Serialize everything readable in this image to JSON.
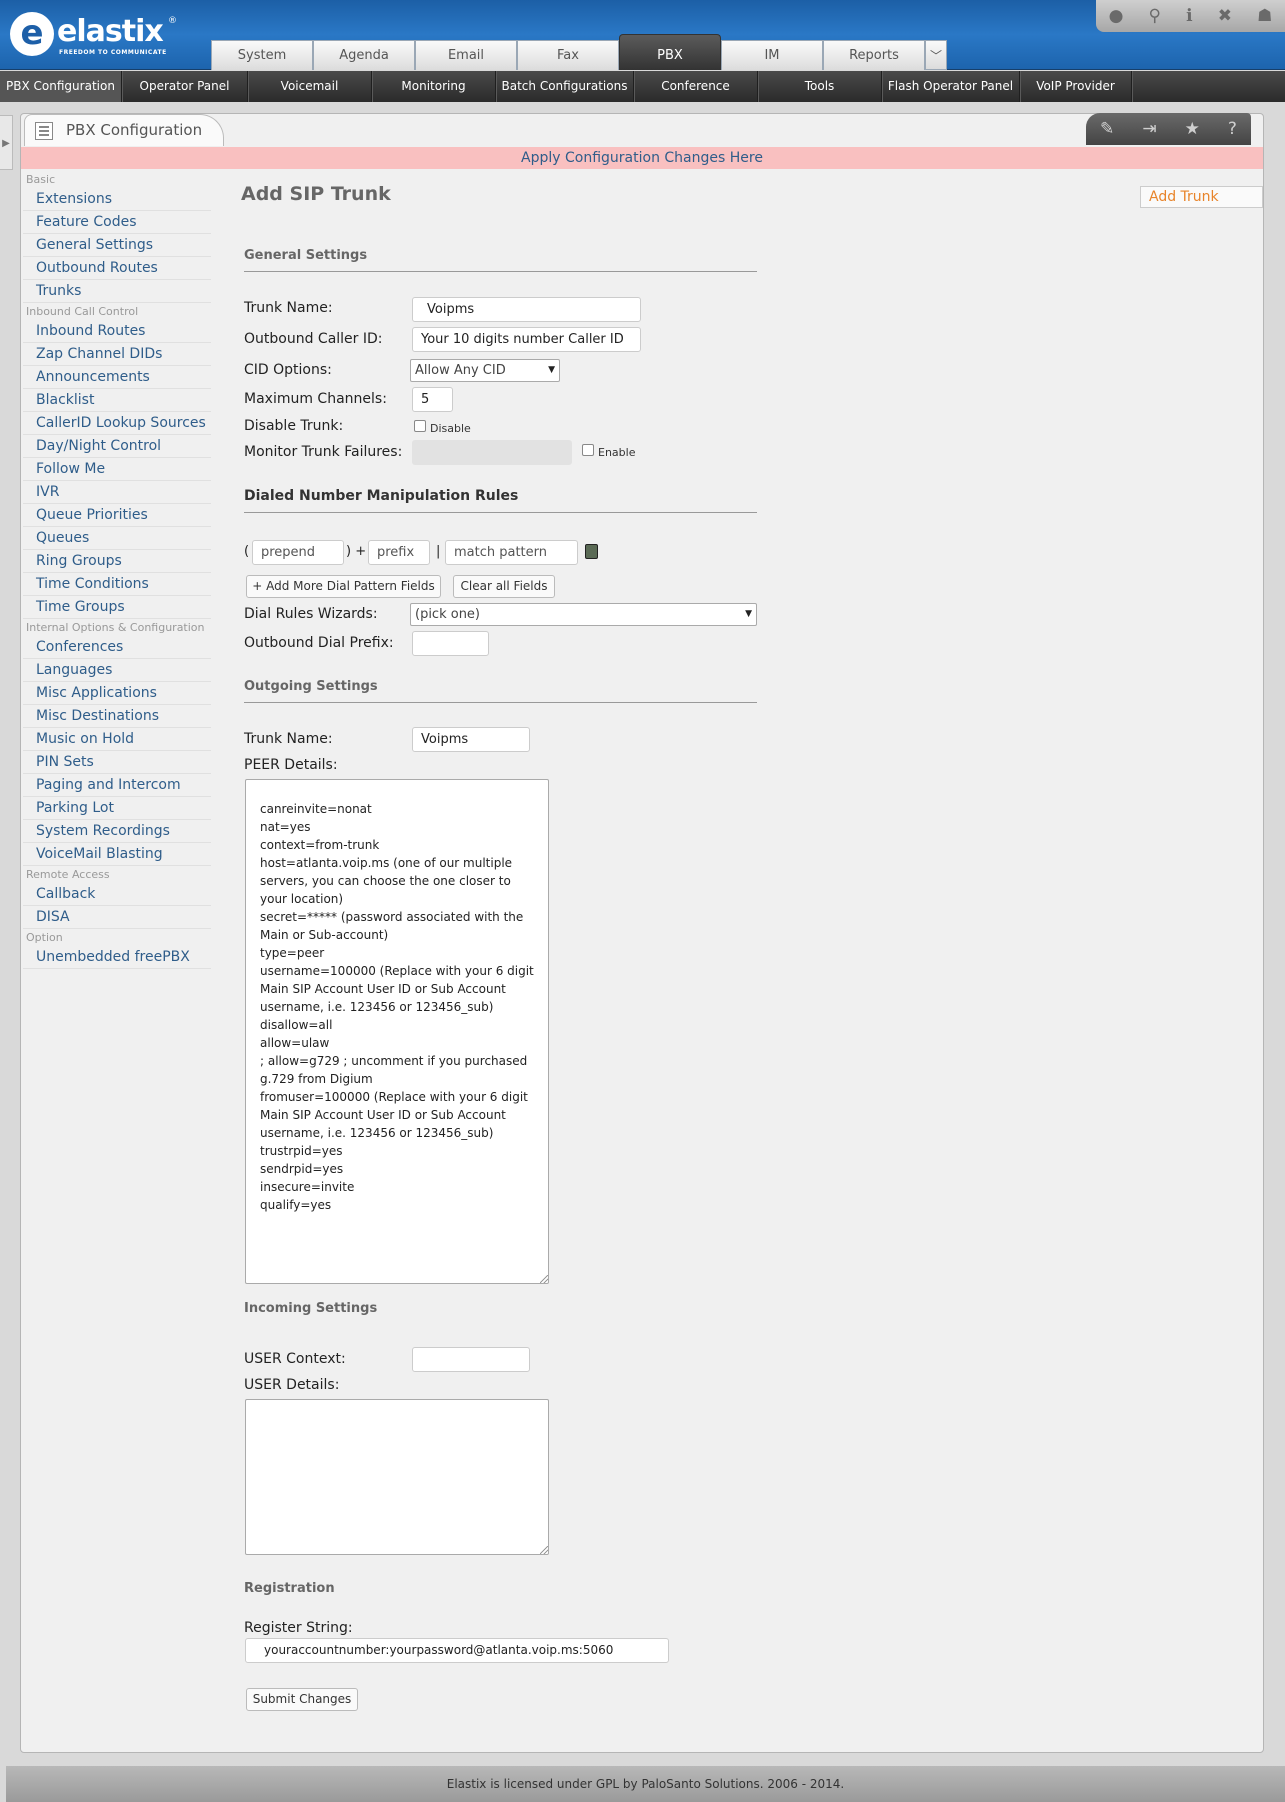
{
  "logo": {
    "word": "elastix",
    "reg": "®",
    "tagline": "FREEDOM TO COMMUNICATE"
  },
  "main_tabs": [
    "System",
    "Agenda",
    "Email",
    "Fax",
    "PBX",
    "IM",
    "Reports"
  ],
  "active_main_tab": "PBX",
  "top_icons": [
    "theme-icon",
    "search-icon",
    "info-icon",
    "tools-icon",
    "user-icon"
  ],
  "subnav": [
    "PBX Configuration",
    "Operator Panel",
    "Voicemail",
    "Monitoring",
    "Batch Configurations",
    "Conference",
    "Tools",
    "Flash Operator Panel",
    "VoIP Provider"
  ],
  "panel": {
    "title": "PBX Configuration",
    "apply_text": "Apply Configuration Changes Here"
  },
  "panel_tools": [
    "edit-icon",
    "expand-icon",
    "star-icon",
    "help-icon"
  ],
  "sidebar": {
    "basic": {
      "title": "Basic",
      "items": [
        "Extensions",
        "Feature Codes",
        "General Settings",
        "Outbound Routes",
        "Trunks"
      ]
    },
    "inbound": {
      "title": "Inbound Call Control",
      "items": [
        "Inbound Routes",
        "Zap Channel DIDs",
        "Announcements",
        "Blacklist",
        "CallerID Lookup Sources",
        "Day/Night Control",
        "Follow Me",
        "IVR",
        "Queue Priorities",
        "Queues",
        "Ring Groups",
        "Time Conditions",
        "Time Groups"
      ]
    },
    "internal": {
      "title": "Internal Options & Configuration",
      "items": [
        "Conferences",
        "Languages",
        "Misc Applications",
        "Misc Destinations",
        "Music on Hold",
        "PIN Sets",
        "Paging and Intercom",
        "Parking Lot",
        "System Recordings",
        "VoiceMail Blasting"
      ]
    },
    "remote": {
      "title": "Remote Access",
      "items": [
        "Callback",
        "DISA"
      ]
    },
    "option": {
      "title": "Option",
      "items": [
        "Unembedded freePBX"
      ]
    }
  },
  "form": {
    "page_title": "Add SIP Trunk",
    "add_trunk_link": "Add Trunk",
    "general_title": "General Settings",
    "trunk_name_label": "Trunk Name:",
    "trunk_name_value": "Voipms",
    "cid_label": "Outbound Caller ID:",
    "cid_value": "Your 10 digits number Caller ID",
    "cid_options_label": "CID Options:",
    "cid_options_value": "Allow Any CID",
    "max_channels_label": "Maximum Channels:",
    "max_channels_value": "5",
    "disable_label": "Disable Trunk:",
    "disable_check_label": "Disable",
    "monitor_label": "Monitor Trunk Failures:",
    "monitor_check_label": "Enable",
    "dial_rules_title": "Dialed Number Manipulation Rules",
    "paren_open": "(",
    "paren_close": ") +",
    "pipe": "|",
    "prepend_ph": "prepend",
    "prefix_ph": "prefix",
    "match_ph": "match pattern",
    "add_more_btn": "+ Add More Dial Pattern Fields",
    "clear_btn": "Clear all Fields",
    "wizards_label": "Dial Rules Wizards:",
    "wizards_value": "(pick one)",
    "dial_prefix_label": "Outbound Dial Prefix:",
    "outgoing_title": "Outgoing Settings",
    "out_trunk_label": "Trunk Name:",
    "out_trunk_value": "Voipms",
    "peer_label": "PEER Details:",
    "peer_details": "canreinvite=nonat\nnat=yes\ncontext=from-trunk\nhost=atlanta.voip.ms (one of our multiple servers, you can choose the one closer to your location)\nsecret=***** (password associated with the Main or Sub-account)\ntype=peer\nusername=100000 (Replace with your 6 digit Main SIP Account User ID or Sub Account username, i.e. 123456 or 123456_sub)\ndisallow=all\nallow=ulaw\n; allow=g729 ; uncomment if you purchased g.729 from Digium\nfromuser=100000 (Replace with your 6 digit Main SIP Account User ID or Sub Account username, i.e. 123456 or 123456_sub)\ntrustrpid=yes\nsendrpid=yes\ninsecure=invite\nqualify=yes",
    "incoming_title": "Incoming Settings",
    "user_context_label": "USER Context:",
    "user_details_label": "USER Details:",
    "registration_title": "Registration",
    "register_label": "Register String:",
    "register_value": "youraccountnumber:yourpassword@atlanta.voip.ms:5060",
    "submit_btn": "Submit Changes"
  },
  "footer": "Elastix is licensed under GPL by PaloSanto Solutions. 2006 - 2014."
}
